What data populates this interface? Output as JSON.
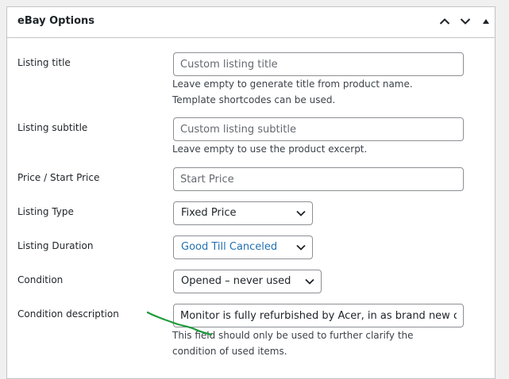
{
  "panel": {
    "title": "eBay Options"
  },
  "fields": {
    "listing_title": {
      "label": "Listing title",
      "placeholder": "Custom listing title",
      "value": "",
      "description": "Leave empty to generate title from product name. Template shortcodes can be used."
    },
    "listing_subtitle": {
      "label": "Listing subtitle",
      "placeholder": "Custom listing subtitle",
      "value": "",
      "description": "Leave empty to use the product excerpt."
    },
    "price": {
      "label": "Price / Start Price",
      "placeholder": "Start Price",
      "value": ""
    },
    "listing_type": {
      "label": "Listing Type",
      "selected": "Fixed Price"
    },
    "listing_duration": {
      "label": "Listing Duration",
      "selected": "Good Till Canceled"
    },
    "condition": {
      "label": "Condition",
      "selected": "Opened – never used"
    },
    "condition_description": {
      "label": "Condition description",
      "value": "Monitor is fully refurbished by Acer, in as brand new con",
      "description": "This field should only be used to further clarify the condition of used items."
    }
  },
  "icons": {
    "move_up": "chevron-up-icon",
    "move_down": "chevron-down-icon",
    "toggle": "triangle-up-icon",
    "select_arrow": "chevron-down-icon"
  },
  "colors": {
    "link_blue": "#2271b1",
    "annotation_green": "#1e9b3a"
  }
}
